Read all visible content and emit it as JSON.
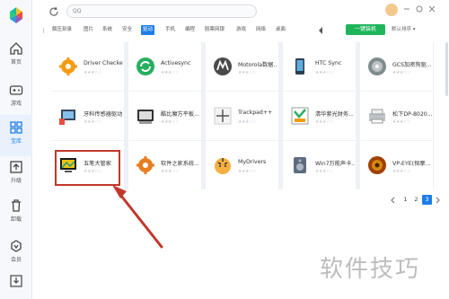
{
  "sidebar": {
    "items": [
      {
        "label": "首页",
        "icon": "home-icon"
      },
      {
        "label": "游戏",
        "icon": "gamepad-icon"
      },
      {
        "label": "宝库",
        "icon": "grid-icon",
        "active": true
      },
      {
        "label": "升级",
        "icon": "upgrade-icon"
      },
      {
        "label": "卸载",
        "icon": "trash-icon"
      },
      {
        "label": "会员",
        "icon": "vip-diamond-icon"
      }
    ]
  },
  "topbar": {
    "search_placeholder": "QQ"
  },
  "categories": [
    "解压刻录",
    "图片",
    "系统",
    "安全",
    "驱动",
    "手机",
    "编程",
    "股票网银",
    "游戏",
    "网络",
    "桌面"
  ],
  "selected_category": "驱动",
  "actions": {
    "one_key_install": "一键装机",
    "sort": "默认排序"
  },
  "apps": [
    {
      "name": "Driver Checker",
      "icon": "gear-icon"
    },
    {
      "name": "Activesync",
      "icon": "sync-icon"
    },
    {
      "name": "Motorola数据...",
      "icon": "motorola-icon"
    },
    {
      "name": "HTC Sync",
      "icon": "phone-icon"
    },
    {
      "name": "GCS加密狗驱...",
      "icon": "cd-icon"
    },
    {
      "name": "牙科传感器驱动",
      "icon": "sensor-icon"
    },
    {
      "name": "酷比魔方平板...",
      "icon": "tablet-icon"
    },
    {
      "name": "Trackpad++",
      "icon": "trackpad-icon"
    },
    {
      "name": "清华紫光财务...",
      "icon": "finance-icon"
    },
    {
      "name": "松下DP-8020...",
      "icon": "printer-icon"
    },
    {
      "name": "五笔大管家",
      "icon": "monitor-icon"
    },
    {
      "name": "软件之家系统...",
      "icon": "gear-orange-icon"
    },
    {
      "name": "MyDrivers",
      "icon": "tiger-icon"
    },
    {
      "name": "Win7万能声卡...",
      "icon": "speaker-icon"
    },
    {
      "name": "VP-EYE(探摩...",
      "icon": "eye-icon"
    }
  ],
  "stars": "★★★☆☆",
  "pagination": {
    "pages": [
      "1",
      "2",
      "3"
    ],
    "current": "3"
  },
  "watermark": "软件技巧",
  "colors": {
    "accent": "#1e7ee8",
    "install_green": "#1fb55b",
    "annotation_red": "#c0392b"
  }
}
